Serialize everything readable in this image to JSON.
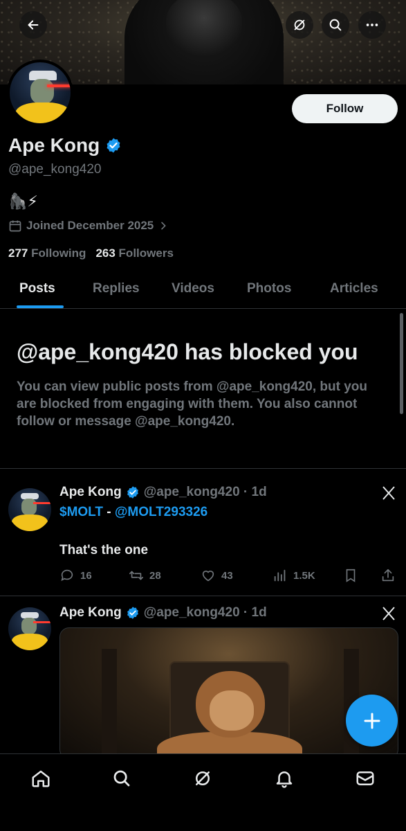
{
  "profile": {
    "name": "Ape Kong",
    "handle": "@ape_kong420",
    "bio": "🦍⚡",
    "joined": "Joined December 2025",
    "following_count": "277",
    "following_label": "Following",
    "followers_count": "263",
    "followers_label": "Followers",
    "follow_label": "Follow"
  },
  "tabs": [
    {
      "label": "Posts",
      "active": true
    },
    {
      "label": "Replies"
    },
    {
      "label": "Videos"
    },
    {
      "label": "Photos"
    },
    {
      "label": "Articles"
    }
  ],
  "blocked": {
    "title": "@ape_kong420 has blocked you",
    "description": "You can view public posts from @ape_kong420, but you are blocked from engaging with them. You also cannot follow or message @ape_kong420."
  },
  "posts": [
    {
      "name": "Ape Kong",
      "meta": "@ape_kong420 · 1d",
      "line1_ticker": "$MOLT",
      "line1_sep": " - ",
      "line1_mention": "@MOLT293326",
      "line2": "That's the one",
      "replies": "16",
      "reposts": "28",
      "likes": "43",
      "views": "1.5K"
    },
    {
      "name": "Ape Kong",
      "meta": "@ape_kong420 · 1d"
    }
  ],
  "icons": {
    "back": "arrow-left-icon",
    "grok": "grok-icon",
    "search": "search-icon",
    "more": "more-icon",
    "verified": "verified-badge-icon",
    "compose": "plus-icon"
  },
  "colors": {
    "accent": "#1d9bf0",
    "text": "#e7e9ea",
    "muted": "#71767b",
    "border": "#2f3336"
  }
}
